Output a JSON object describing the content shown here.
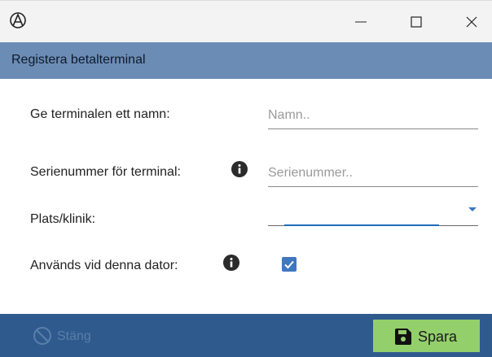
{
  "window": {
    "app_icon": "app-logo-icon",
    "controls": [
      "minimize-icon",
      "maximize-icon",
      "close-icon"
    ]
  },
  "header": {
    "title": "Registera betalterminal"
  },
  "form": {
    "name_label": "Ge terminalen ett namn:",
    "name_placeholder": "Namn..",
    "serial_label": "Serienummer för terminal:",
    "serial_placeholder": "Serienummer..",
    "location_label": "Plats/klinik:",
    "location_value": "",
    "used_label": "Används vid denna dator:",
    "used_checked": true
  },
  "footer": {
    "close_label": "Stäng",
    "save_label": "Spara"
  },
  "colors": {
    "header_bg": "#6b8cb5",
    "footer_bg": "#2f5a8e",
    "accent": "#3d78c0",
    "save_bg": "#93cf6b"
  }
}
